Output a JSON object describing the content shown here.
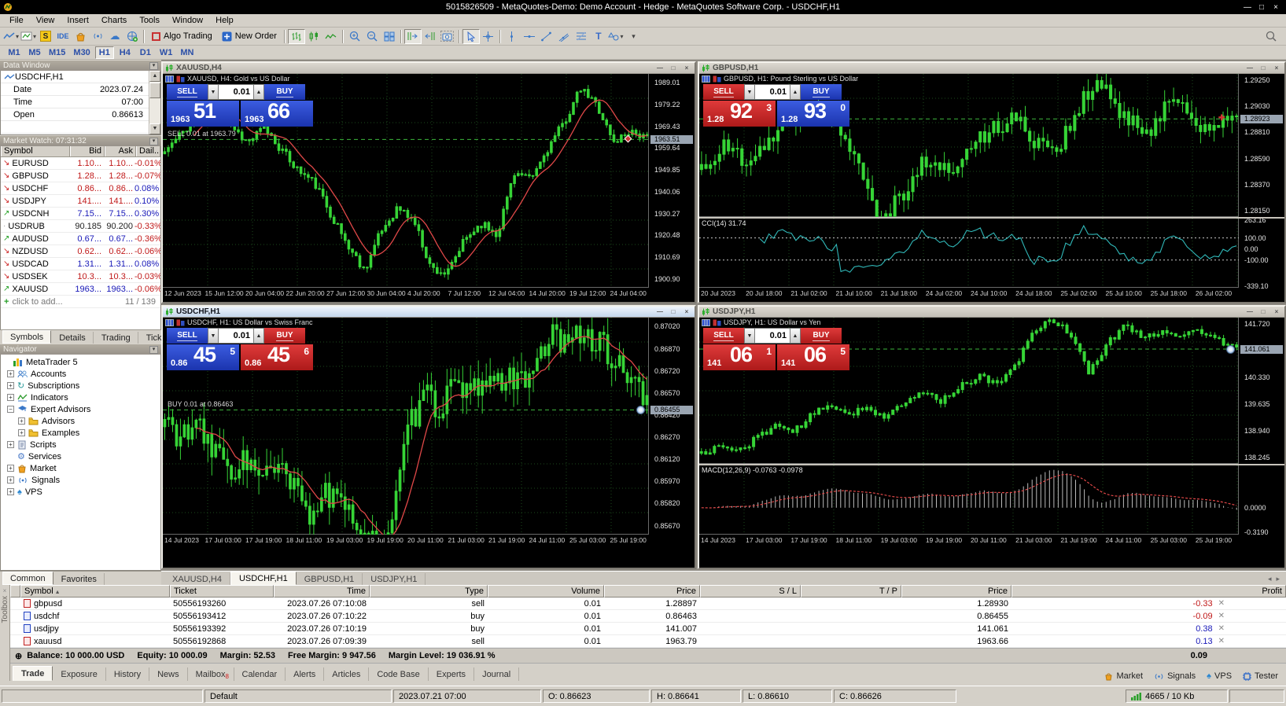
{
  "window": {
    "title": "5015826509 - MetaQuotes-Demo: Demo Account - Hedge - MetaQuotes Software Corp. - USDCHF,H1"
  },
  "menu": [
    "File",
    "View",
    "Insert",
    "Charts",
    "Tools",
    "Window",
    "Help"
  ],
  "toolbar": {
    "algo_trading": "Algo Trading",
    "new_order": "New Order",
    "s_badge": "S",
    "ide": "IDE"
  },
  "timeframes": {
    "items": [
      "M1",
      "M5",
      "M15",
      "M30",
      "H1",
      "H4",
      "D1",
      "W1",
      "MN"
    ],
    "active": "H1"
  },
  "data_window": {
    "title": "Data Window",
    "symbol": "USDCHF,H1",
    "rows": [
      {
        "label": "Date",
        "value": "2023.07.24"
      },
      {
        "label": "Time",
        "value": "07:00"
      },
      {
        "label": "Open",
        "value": "0.86613"
      }
    ]
  },
  "market_watch": {
    "title": "Market Watch: 07:31:32",
    "columns": [
      "Symbol",
      "Bid",
      "Ask",
      "Dail..."
    ],
    "rows": [
      {
        "symbol": "EURUSD",
        "bid": "1.10...",
        "ask": "1.10...",
        "daily": "-0.01%",
        "dir": "down",
        "color": "red"
      },
      {
        "symbol": "GBPUSD",
        "bid": "1.28...",
        "ask": "1.28...",
        "daily": "-0.07%",
        "dir": "down",
        "color": "red"
      },
      {
        "symbol": "USDCHF",
        "bid": "0.86...",
        "ask": "0.86...",
        "daily": "0.08%",
        "dir": "down",
        "color": "red"
      },
      {
        "symbol": "USDJPY",
        "bid": "141....",
        "ask": "141....",
        "daily": "0.10%",
        "dir": "down",
        "color": "red"
      },
      {
        "symbol": "USDCNH",
        "bid": "7.15...",
        "ask": "7.15...",
        "daily": "0.30%",
        "dir": "up",
        "color": "blue"
      },
      {
        "symbol": "USDRUB",
        "bid": "90.185",
        "ask": "90.200",
        "daily": "-0.33%",
        "dir": "none",
        "color": "black"
      },
      {
        "symbol": "AUDUSD",
        "bid": "0.67...",
        "ask": "0.67...",
        "daily": "-0.36%",
        "dir": "up",
        "color": "blue"
      },
      {
        "symbol": "NZDUSD",
        "bid": "0.62...",
        "ask": "0.62...",
        "daily": "-0.06%",
        "dir": "down",
        "color": "red"
      },
      {
        "symbol": "USDCAD",
        "bid": "1.31...",
        "ask": "1.31...",
        "daily": "0.08%",
        "dir": "down",
        "color": "blue"
      },
      {
        "symbol": "USDSEK",
        "bid": "10.3...",
        "ask": "10.3...",
        "daily": "-0.03%",
        "dir": "down",
        "color": "red"
      },
      {
        "symbol": "XAUUSD",
        "bid": "1963...",
        "ask": "1963...",
        "daily": "-0.06%",
        "dir": "up",
        "color": "blue"
      }
    ],
    "add_row": "click to add...",
    "counter": "11 / 139",
    "tabs": [
      "Symbols",
      "Details",
      "Trading",
      "Ticks"
    ],
    "active_tab": "Symbols"
  },
  "navigator": {
    "title": "Navigator",
    "root": "MetaTrader 5",
    "items": [
      {
        "label": "Accounts",
        "icon": "accounts-icon",
        "expand": "plus",
        "indent": 0
      },
      {
        "label": "Subscriptions",
        "icon": "subscriptions-icon",
        "expand": "plus",
        "indent": 0
      },
      {
        "label": "Indicators",
        "icon": "indicators-icon",
        "expand": "plus",
        "indent": 0
      },
      {
        "label": "Expert Advisors",
        "icon": "expert-advisors-icon",
        "expand": "minus",
        "indent": 0
      },
      {
        "label": "Advisors",
        "icon": "folder-icon",
        "expand": "plus",
        "indent": 1
      },
      {
        "label": "Examples",
        "icon": "folder-icon",
        "expand": "plus",
        "indent": 1
      },
      {
        "label": "Scripts",
        "icon": "scripts-icon",
        "expand": "plus",
        "indent": 0
      },
      {
        "label": "Services",
        "icon": "services-icon",
        "expand": "none",
        "indent": 0
      },
      {
        "label": "Market",
        "icon": "market-icon",
        "expand": "plus",
        "indent": 0
      },
      {
        "label": "Signals",
        "icon": "signals-icon",
        "expand": "plus",
        "indent": 0
      },
      {
        "label": "VPS",
        "icon": "vps-icon",
        "expand": "plus",
        "indent": 0
      }
    ],
    "tabs": [
      "Common",
      "Favorites"
    ],
    "active_tab": "Common"
  },
  "charts": [
    {
      "id": "xauusd",
      "title": "XAUUSD,H4",
      "desc": "XAUUSD, H4:  Gold vs US Dollar",
      "sell": "SELL",
      "buy": "BUY",
      "lot": "0.01",
      "sell_side": "blue",
      "buy_side": "blue",
      "sell_price": {
        "small": "1963",
        "big": "51",
        "sup": ""
      },
      "buy_price": {
        "small": "1963",
        "big": "66",
        "sup": ""
      },
      "trade_label": "SELL 0.01 at 1963.79",
      "hl_tag": "1963.51",
      "price_axis": [
        "1989.01",
        "1979.22",
        "1969.43",
        "1959.64",
        "1949.85",
        "1940.06",
        "1930.27",
        "1920.48",
        "1910.69",
        "1900.90"
      ],
      "time_axis": [
        "12 Jun 2023",
        "15 Jun 12:00",
        "20 Jun 04:00",
        "22 Jun 20:00",
        "27 Jun 12:00",
        "30 Jun 04:00",
        "4 Jul 20:00",
        "7 Jul 12:00",
        "12 Jul 04:00",
        "14 Jul 20:00",
        "19 Jul 12:00",
        "24 Jul 04:00"
      ],
      "indicator": null,
      "active": false
    },
    {
      "id": "gbpusd",
      "title": "GBPUSD,H1",
      "desc": "GBPUSD, H1:  Pound Sterling vs US Dollar",
      "sell": "SELL",
      "buy": "BUY",
      "lot": "0.01",
      "sell_side": "red",
      "buy_side": "blue",
      "sell_price": {
        "small": "1.28",
        "big": "92",
        "sup": "3"
      },
      "buy_price": {
        "small": "1.28",
        "big": "93",
        "sup": "0"
      },
      "trade_label": "",
      "hl_tag": "1.28923",
      "price_axis": [
        "1.29250",
        "1.29030",
        "1.28810",
        "1.28590",
        "1.28370",
        "1.28150"
      ],
      "time_axis": [
        "20 Jul 2023",
        "20 Jul 18:00",
        "21 Jul 02:00",
        "21 Jul 10:00",
        "21 Jul 18:00",
        "24 Jul 02:00",
        "24 Jul 10:00",
        "24 Jul 18:00",
        "25 Jul 02:00",
        "25 Jul 10:00",
        "25 Jul 18:00",
        "26 Jul 02:00"
      ],
      "indicator": {
        "type": "cci",
        "label": "CCI(14) 31.74",
        "axis": [
          "263.16",
          "100.00",
          "0.00",
          "-100.00",
          "-339.10"
        ]
      },
      "active": false
    },
    {
      "id": "usdchf",
      "title": "USDCHF,H1",
      "desc": "USDCHF, H1:  US Dollar vs Swiss Franc",
      "sell": "SELL",
      "buy": "BUY",
      "lot": "0.01",
      "sell_side": "blue",
      "buy_side": "red",
      "sell_price": {
        "small": "0.86",
        "big": "45",
        "sup": "5"
      },
      "buy_price": {
        "small": "0.86",
        "big": "45",
        "sup": "6"
      },
      "trade_label": "BUY 0.01 at 0.86463",
      "hl_tag": "0.86455",
      "price_axis": [
        "0.87020",
        "0.86870",
        "0.86720",
        "0.86570",
        "0.86420",
        "0.86270",
        "0.86120",
        "0.85970",
        "0.85820",
        "0.85670"
      ],
      "time_axis": [
        "14 Jul 2023",
        "17 Jul 03:00",
        "17 Jul 19:00",
        "18 Jul 11:00",
        "19 Jul 03:00",
        "19 Jul 19:00",
        "20 Jul 11:00",
        "21 Jul 03:00",
        "21 Jul 19:00",
        "24 Jul 11:00",
        "25 Jul 03:00",
        "25 Jul 19:00"
      ],
      "indicator": null,
      "active": true
    },
    {
      "id": "usdjpy",
      "title": "USDJPY,H1",
      "desc": "USDJPY, H1:  US Dollar vs Yen",
      "sell": "SELL",
      "buy": "BUY",
      "lot": "0.01",
      "sell_side": "red",
      "buy_side": "red",
      "sell_price": {
        "small": "141",
        "big": "06",
        "sup": "1"
      },
      "buy_price": {
        "small": "141",
        "big": "06",
        "sup": "5"
      },
      "trade_label": "",
      "hl_tag": "141.061",
      "price_axis": [
        "141.720",
        "140.330",
        "139.635",
        "138.940",
        "138.245"
      ],
      "time_axis": [
        "14 Jul 2023",
        "17 Jul 03:00",
        "17 Jul 19:00",
        "18 Jul 11:00",
        "19 Jul 03:00",
        "19 Jul 19:00",
        "20 Jul 11:00",
        "21 Jul 03:00",
        "21 Jul 19:00",
        "24 Jul 11:00",
        "25 Jul 03:00",
        "25 Jul 19:00"
      ],
      "indicator": {
        "type": "macd",
        "label": "MACD(12,26,9) -0.0763 -0.0978",
        "axis": [
          "0.0000",
          "-0.3190"
        ]
      },
      "active": false
    }
  ],
  "chart_tabs": {
    "items": [
      "XAUUSD,H4",
      "USDCHF,H1",
      "GBPUSD,H1",
      "USDJPY,H1"
    ],
    "active": "USDCHF,H1"
  },
  "toolbox": {
    "side_label": "Toolbox",
    "columns": [
      "Symbol",
      "Ticket",
      "Time",
      "Type",
      "Volume",
      "Price",
      "S / L",
      "T / P",
      "Price",
      "Profit"
    ],
    "positions": [
      {
        "symbol": "gbpusd",
        "ticket": "50556193260",
        "time": "2023.07.26 07:10:08",
        "type": "sell",
        "volume": "0.01",
        "price": "1.28897",
        "sl": "",
        "tp": "",
        "price2": "1.28930",
        "profit": "-0.33",
        "profit_color": "red"
      },
      {
        "symbol": "usdchf",
        "ticket": "50556193412",
        "time": "2023.07.26 07:10:22",
        "type": "buy",
        "volume": "0.01",
        "price": "0.86463",
        "sl": "",
        "tp": "",
        "price2": "0.86455",
        "profit": "-0.09",
        "profit_color": "red"
      },
      {
        "symbol": "usdjpy",
        "ticket": "50556193392",
        "time": "2023.07.26 07:10:19",
        "type": "buy",
        "volume": "0.01",
        "price": "141.007",
        "sl": "",
        "tp": "",
        "price2": "141.061",
        "profit": "0.38",
        "profit_color": "blue"
      },
      {
        "symbol": "xauusd",
        "ticket": "50556192868",
        "time": "2023.07.26 07:09:39",
        "type": "sell",
        "volume": "0.01",
        "price": "1963.79",
        "sl": "",
        "tp": "",
        "price2": "1963.66",
        "profit": "0.13",
        "profit_color": "blue"
      }
    ],
    "balance_segments": [
      "Balance: 10 000.00 USD",
      "Equity: 10 000.09",
      "Margin: 52.53",
      "Free Margin: 9 947.56",
      "Margin Level: 19 036.91 %"
    ],
    "balance_profit": "0.09",
    "tabs": [
      "Trade",
      "Exposure",
      "History",
      "News",
      "Mailbox",
      "Calendar",
      "Alerts",
      "Articles",
      "Code Base",
      "Experts",
      "Journal"
    ],
    "active_tab": "Trade",
    "mailbox_badge": "8",
    "right_links": [
      "Market",
      "Signals",
      "VPS",
      "Tester"
    ]
  },
  "status_bar": {
    "profile": "Default",
    "datetime": "2023.07.21 07:00",
    "o": "O: 0.86623",
    "h": "H: 0.86641",
    "l": "L: 0.86610",
    "c": "C: 0.86626",
    "traffic": "4665 / 10 Kb"
  },
  "colors": {
    "bull_candle": "#36d436",
    "ma_line": "#e04848",
    "trade_line": "#3db83d",
    "cci_line": "#30b8b8",
    "macd_hist": "#bcbcbc",
    "sell_red": "#c32020",
    "buy_blue": "#1f3fd4"
  }
}
